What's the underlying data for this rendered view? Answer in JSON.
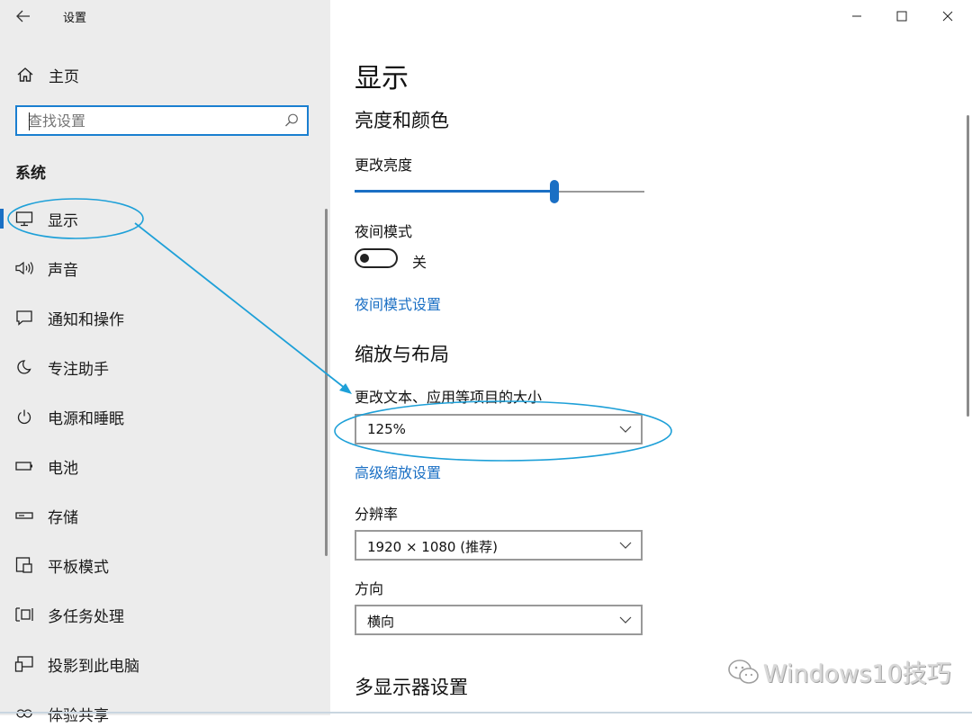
{
  "window": {
    "title": "设置",
    "controls": {
      "minimize": "minimize-icon",
      "maximize": "maximize-icon",
      "close": "close-icon"
    }
  },
  "sidebar": {
    "home_label": "主页",
    "search_placeholder": "查找设置",
    "section_label": "系统",
    "items": [
      {
        "label": "显示",
        "icon": "monitor-icon",
        "active": true
      },
      {
        "label": "声音",
        "icon": "speaker-icon"
      },
      {
        "label": "通知和操作",
        "icon": "notification-icon"
      },
      {
        "label": "专注助手",
        "icon": "moon-icon"
      },
      {
        "label": "电源和睡眠",
        "icon": "power-icon"
      },
      {
        "label": "电池",
        "icon": "battery-icon"
      },
      {
        "label": "存储",
        "icon": "storage-icon"
      },
      {
        "label": "平板模式",
        "icon": "tablet-icon"
      },
      {
        "label": "多任务处理",
        "icon": "multitask-icon"
      },
      {
        "label": "投影到此电脑",
        "icon": "project-icon"
      },
      {
        "label": "体验共享",
        "icon": "share-icon"
      }
    ]
  },
  "main": {
    "page_title": "显示",
    "brightness": {
      "heading": "亮度和颜色",
      "label": "更改亮度",
      "level": 0.69
    },
    "night_light": {
      "label": "夜间模式",
      "toggle_state": "关",
      "settings_link": "夜间模式设置"
    },
    "scale_layout": {
      "heading": "缩放与布局",
      "size_label": "更改文本、应用等项目的大小",
      "size_value": "125%",
      "advanced_link": "高级缩放设置",
      "resolution_label": "分辨率",
      "resolution_value": "1920 × 1080 (推荐)",
      "orientation_label": "方向",
      "orientation_value": "横向"
    },
    "multi_display_heading": "多显示器设置"
  },
  "watermark": {
    "text": "Windows10技巧",
    "icon": "wechat-icon"
  },
  "colors": {
    "accent": "#1a6fc4",
    "annotation": "#1ea0d8",
    "sidebar_bg": "#ececec"
  }
}
